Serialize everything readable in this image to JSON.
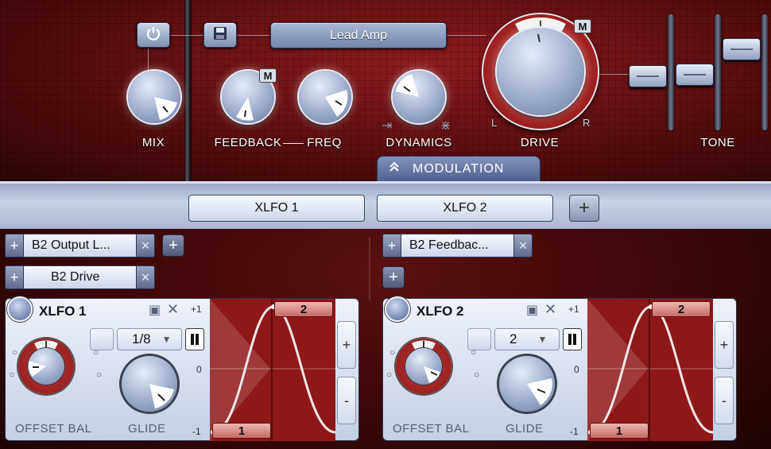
{
  "colors": {
    "panel_red": "#8e1c1e",
    "accent_blue": "#7f93bb",
    "wave_red": "#8e1818",
    "knob_ring_red": "#b52a2a"
  },
  "amp": {
    "preset_name": "Lead Amp",
    "labels": {
      "mix": "MIX",
      "feedback": "FEEDBACK",
      "freq": "FREQ",
      "dynamics": "DYNAMICS",
      "drive": "DRIVE",
      "tone": "TONE"
    },
    "drive_l": "L",
    "drive_r": "R",
    "mod_badge": "M",
    "modulation_tab": "MODULATION",
    "icons": {
      "power": "power-icon",
      "save": "save-icon",
      "chevron": "chevron-up-icon"
    }
  },
  "modulation": {
    "tabs": [
      "XLFO 1",
      "XLFO 2"
    ],
    "add_symbol": "+",
    "remove_symbol": "×",
    "lfos": [
      {
        "title": "XLFO 1",
        "targets": [
          "B2 Output L...",
          "B2 Drive"
        ],
        "rate": "1/8",
        "knob_labels": [
          "OFFSET BAL",
          "GLIDE"
        ],
        "axis": [
          "+1",
          "0",
          "-1"
        ],
        "steps": [
          "1",
          "2"
        ],
        "side_buttons": [
          "+",
          "-"
        ]
      },
      {
        "title": "XLFO 2",
        "targets": [
          "B2 Feedbac..."
        ],
        "rate": "2",
        "knob_labels": [
          "OFFSET BAL",
          "GLIDE"
        ],
        "axis": [
          "+1",
          "0",
          "-1"
        ],
        "steps": [
          "1",
          "2"
        ],
        "side_buttons": [
          "+",
          "-"
        ]
      }
    ]
  }
}
